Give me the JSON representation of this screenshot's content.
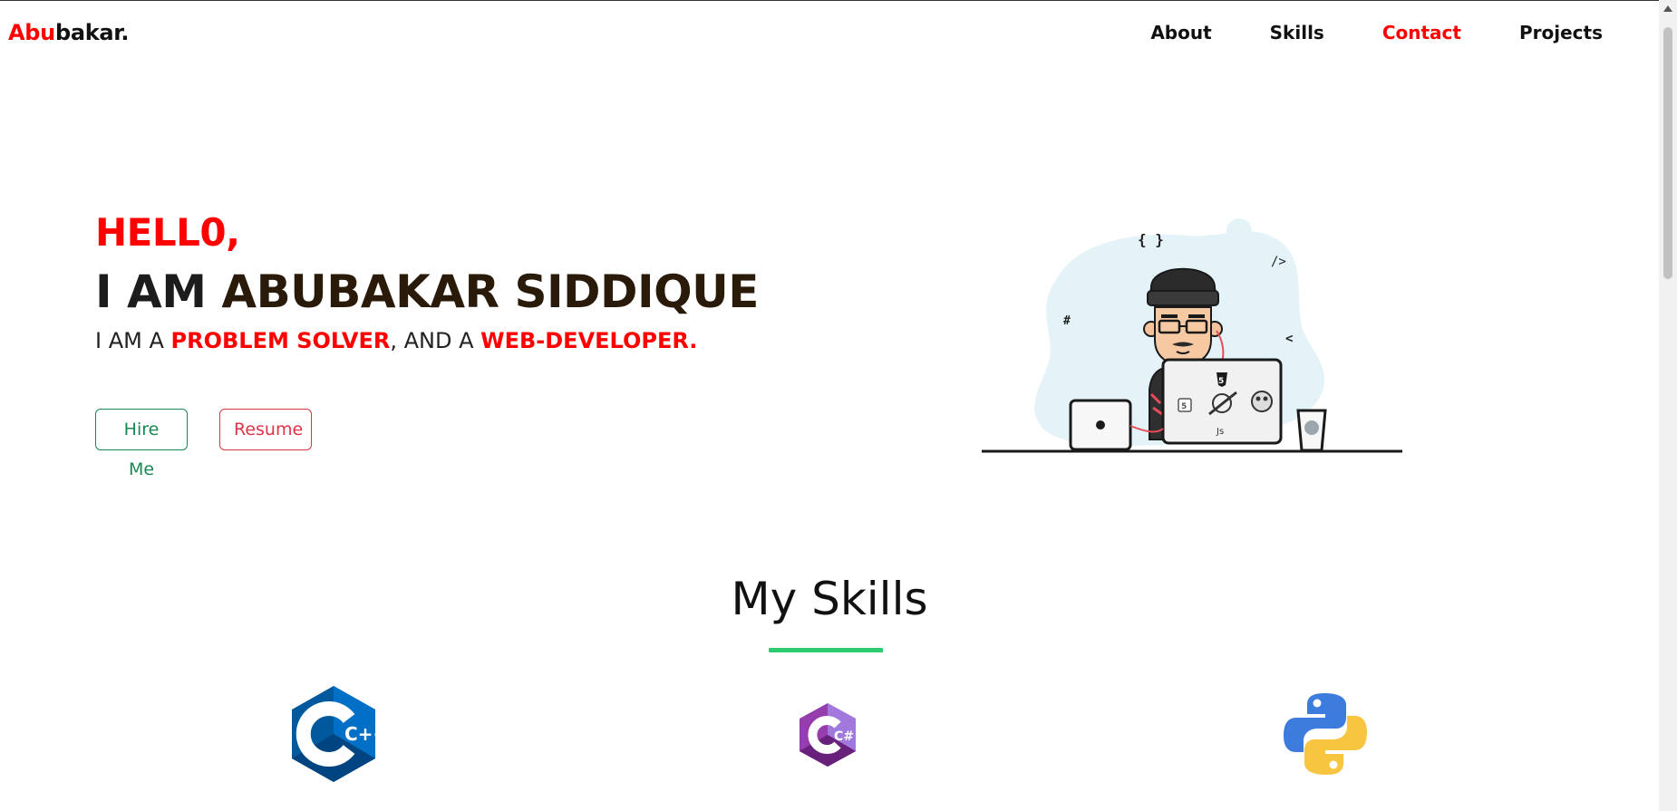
{
  "brand": {
    "part1": "Abu",
    "part2": "bakar."
  },
  "nav": {
    "items": [
      {
        "label": "About"
      },
      {
        "label": "Skills"
      },
      {
        "label": "Contact"
      },
      {
        "label": "Projects"
      }
    ],
    "active": "Contact"
  },
  "hero": {
    "hello": "HELL0,",
    "iam_prefix": "I AM ",
    "name": "ABUBAKAR SIDDIQUE",
    "tagline": {
      "prefix": "I AM A ",
      "role1": "PROBLEM SOLVER",
      "mid": ", AND A ",
      "role2": "WEB-DEVELOPER."
    },
    "buttons": {
      "hire": "Hire Me",
      "resume": "Resume"
    }
  },
  "illustration": {
    "glyphs": [
      "{ }",
      "/>",
      "#",
      "<",
      "5",
      "5",
      "Js"
    ]
  },
  "skills": {
    "title": "My Skills",
    "items": [
      {
        "name": "cpp-logo",
        "label": "C++"
      },
      {
        "name": "csharp-logo",
        "label": "C#"
      },
      {
        "name": "python-logo"
      }
    ]
  },
  "colors": {
    "accent": "#ff0000",
    "success": "#198754",
    "danger": "#dc3545",
    "underline": "#2ecc71"
  }
}
